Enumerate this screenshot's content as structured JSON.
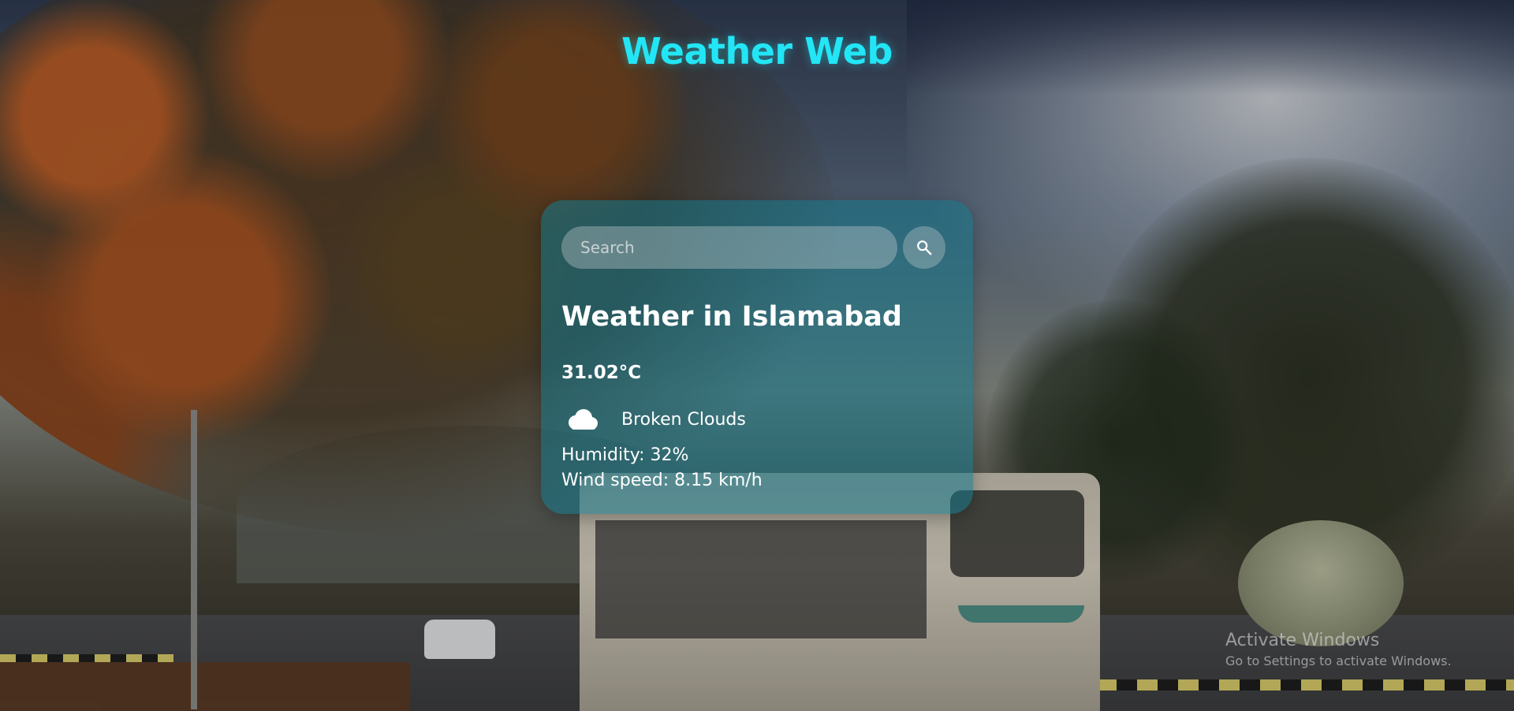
{
  "app": {
    "title": "Weather Web",
    "accent_color": "#22e6f5"
  },
  "search": {
    "placeholder": "Search",
    "value": "",
    "button_icon": "search-icon"
  },
  "weather": {
    "heading": "Weather in Islamabad",
    "temperature": "31.02°C",
    "icon": "cloud-icon",
    "description": "Broken Clouds",
    "humidity": "Humidity: 32%",
    "wind": "Wind speed: 8.15 km/h"
  },
  "windows_watermark": {
    "title": "Activate Windows",
    "subtitle": "Go to Settings to activate Windows."
  }
}
